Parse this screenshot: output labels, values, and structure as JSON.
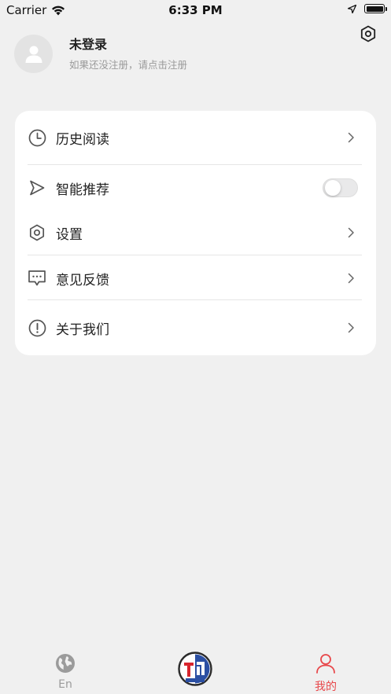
{
  "status_bar": {
    "carrier": "Carrier",
    "time": "6:33 PM"
  },
  "profile": {
    "name": "未登录",
    "hint": "如果还没注册，请点击注册"
  },
  "menu": {
    "items": [
      {
        "label": "历史阅读",
        "icon": "clock-icon",
        "control": "chevron"
      },
      {
        "label": "智能推荐",
        "icon": "send-icon",
        "control": "toggle",
        "enabled": false
      },
      {
        "label": "设置",
        "icon": "hexagon-settings-icon",
        "control": "chevron"
      },
      {
        "label": "意见反馈",
        "icon": "chat-bubble-icon",
        "control": "chevron"
      },
      {
        "label": "关于我们",
        "icon": "info-exclamation-icon",
        "control": "chevron"
      }
    ]
  },
  "tabbar": {
    "tabs": [
      {
        "label": "En",
        "icon": "globe-icon",
        "active": false
      },
      {
        "label": "",
        "icon": "app-logo-icon",
        "active": false
      },
      {
        "label": "我的",
        "icon": "person-icon",
        "active": true
      }
    ]
  },
  "colors": {
    "accent": "#e8474a",
    "background": "#f0f0f0",
    "card": "#ffffff",
    "muted_text": "#9a9a9a"
  }
}
